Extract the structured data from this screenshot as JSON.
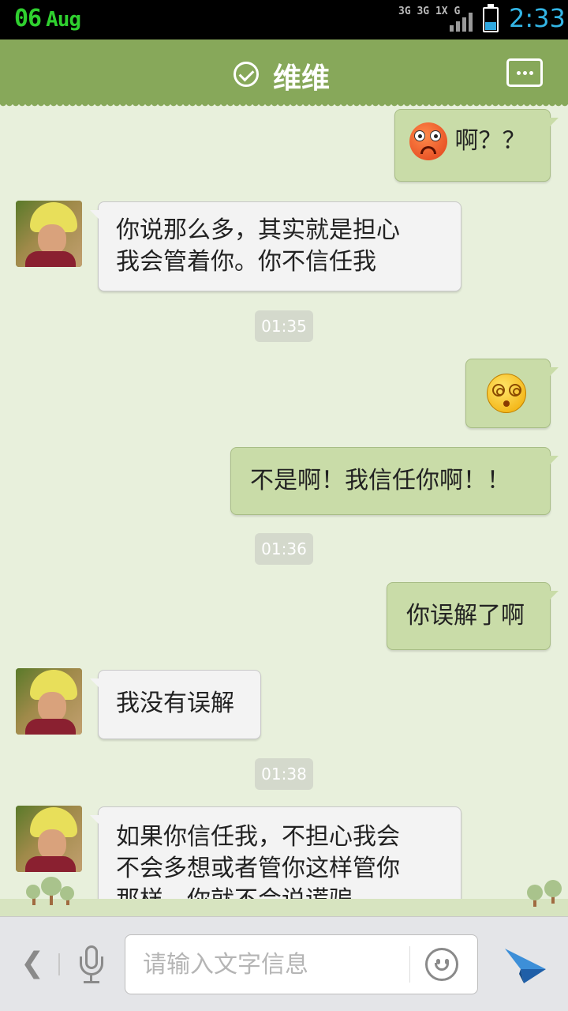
{
  "status_bar": {
    "date_day": "06",
    "date_month": "Aug",
    "network_top": "3G 3G 1X G",
    "time": "2:33"
  },
  "header": {
    "title": "维维",
    "verified_icon": "check-circle-icon",
    "more_icon": "chat-more-icon"
  },
  "messages": [
    {
      "dir": "out",
      "kind": "emoji+text",
      "emoji": "sad-face",
      "text": "啊？？"
    },
    {
      "dir": "in",
      "lines": [
        "你说那么多，其实就是担心",
        "我会管着你。你不信任我"
      ]
    },
    {
      "time": "01:35"
    },
    {
      "dir": "out",
      "kind": "emoji",
      "emoji": "dizzy-face"
    },
    {
      "dir": "out",
      "text": "不是啊！我信任你啊！！"
    },
    {
      "time": "01:36"
    },
    {
      "dir": "out",
      "text": "你误解了啊"
    },
    {
      "dir": "in",
      "text": "我没有误解"
    },
    {
      "time": "01:38"
    },
    {
      "dir": "in",
      "lines": [
        "如果你信任我，不担心我会",
        "不会多想或者管你这样管你",
        "那样，你就不会说谎骗"
      ]
    }
  ],
  "input_bar": {
    "placeholder": "请输入文字信息",
    "value": "",
    "back_icon": "chevron-left-icon",
    "mic_icon": "microphone-icon",
    "emoji_icon": "smiley-icon",
    "send_icon": "send-icon"
  },
  "colors": {
    "header_bg": "#87a85a",
    "chat_bg": "#e8f0dc",
    "outgoing_bubble": "#c9dca8",
    "incoming_bubble": "#f3f3f3",
    "time_accent": "#33b5e5"
  }
}
